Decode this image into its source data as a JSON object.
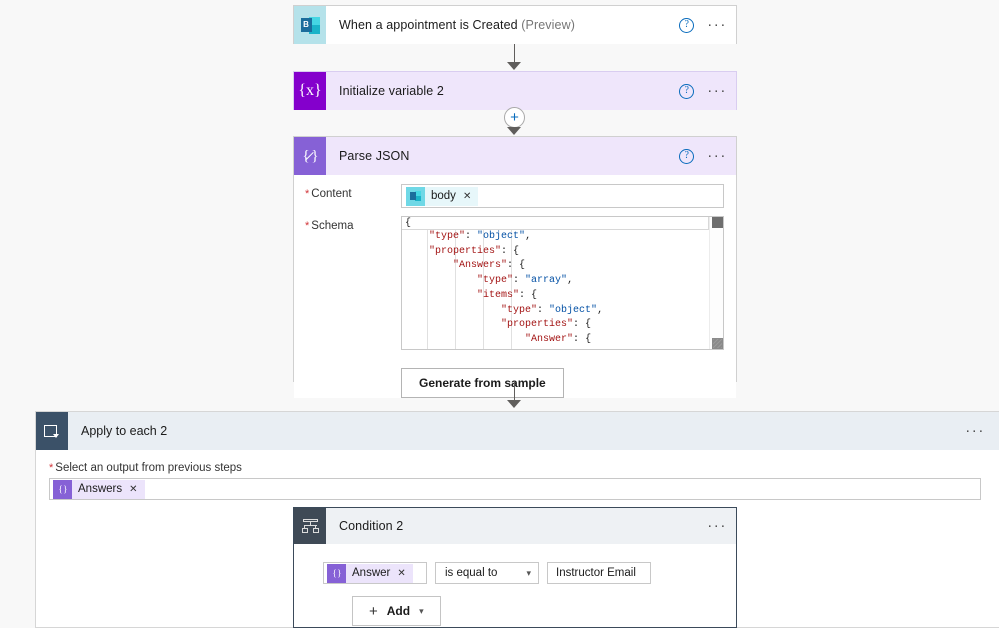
{
  "flow": {
    "trigger": {
      "title": "When a appointment is Created",
      "preview_suffix": "(Preview)",
      "icon": "bookings-icon",
      "help_label": "?",
      "menu_label": "···"
    },
    "initialize_variable": {
      "title": "Initialize variable 2",
      "icon": "variable-braces-icon",
      "icon_text": "{x}",
      "help_label": "?",
      "menu_label": "···"
    },
    "parse_json": {
      "title": "Parse JSON",
      "icon": "parse-json-icon",
      "icon_text": "{ }",
      "help_label": "?",
      "menu_label": "···",
      "content_field": {
        "label": "Content",
        "required_mark": "*",
        "token_label": "body",
        "token_remove": "✕"
      },
      "schema_field": {
        "label": "Schema",
        "required_mark": "*",
        "first_line": "{",
        "code_lines": [
          {
            "indent": 4,
            "key": "\"type\"",
            "value": "\"object\"",
            "trail": ","
          },
          {
            "indent": 4,
            "key": "\"properties\"",
            "value": "{",
            "trail": ""
          },
          {
            "indent": 8,
            "key": "\"Answers\"",
            "value": "{",
            "trail": ""
          },
          {
            "indent": 12,
            "key": "\"type\"",
            "value": "\"array\"",
            "trail": ","
          },
          {
            "indent": 12,
            "key": "\"items\"",
            "value": "{",
            "trail": ""
          },
          {
            "indent": 16,
            "key": "\"type\"",
            "value": "\"object\"",
            "trail": ","
          },
          {
            "indent": 16,
            "key": "\"properties\"",
            "value": "{",
            "trail": ""
          },
          {
            "indent": 20,
            "key": "\"Answer\"",
            "value": "{",
            "trail": ""
          }
        ]
      },
      "generate_button": "Generate from sample"
    },
    "apply_to_each": {
      "title": "Apply to each 2",
      "icon": "foreach-loop-icon",
      "menu_label": "···",
      "output_field": {
        "label": "Select an output from previous steps",
        "required_mark": "*",
        "token_label": "Answers",
        "token_remove": "✕"
      }
    },
    "condition": {
      "title": "Condition 2",
      "icon": "condition-branch-icon",
      "menu_label": "···",
      "left_token": "Answer",
      "left_token_remove": "✕",
      "operator": "is equal to",
      "operator_chevron": "⌵",
      "right_value": "Instructor Email",
      "add_button": {
        "plus": "+",
        "label": "Add",
        "chevron": "⌵"
      }
    },
    "connector": {
      "insert_plus": "+"
    }
  },
  "colors": {
    "page_background": "#f8f8f8",
    "trigger_icon_bg": "#b5e2ea",
    "variable_icon_bg": "#8400cc",
    "variable_card_bg": "#efe6fb",
    "parse_json_icon_bg": "#8661d6",
    "foreach_icon_bg": "#3b5168",
    "foreach_header_bg": "#e9eef3",
    "condition_icon_bg": "#3f4a56",
    "condition_border": "#3b4a5a",
    "help_icon_blue": "#0a6cbd",
    "required_red": "#d13438",
    "json_key": "#a31515",
    "json_value": "#0451a5",
    "connector_line": "#605e5c"
  }
}
